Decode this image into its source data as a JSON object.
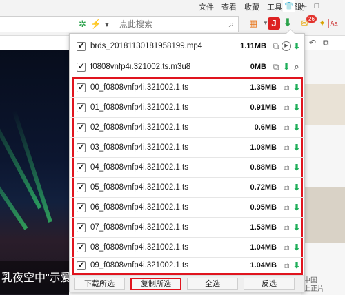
{
  "menubar": {
    "items": [
      "文件",
      "查看",
      "收藏",
      "工具",
      "帮助"
    ],
    "window_controls": {
      "shirt_icon": "shirt-icon",
      "minimize": "—",
      "maximize": "□"
    }
  },
  "toolbar": {
    "search_placeholder": "点此搜索",
    "icons": [
      "refresh-spin-icon",
      "lightning-icon",
      "chevron-down-icon",
      "search-icon",
      "apps-icon",
      "music-icon",
      "video-sniffer-icon",
      "chat-icon",
      "mail-icon",
      "pdf-icon"
    ],
    "music_glyph": "J",
    "pdf_glyph": "Aa",
    "chat_badge": "26"
  },
  "page": {
    "caption": "乳夜空中\"示爱\"",
    "right_text_1": "中国",
    "right_text_2": "上正片"
  },
  "popup": {
    "files": [
      {
        "name": "brds_20181130181958199.mp4",
        "size": "1.11MB",
        "actions": [
          "copy",
          "play",
          "download"
        ]
      },
      {
        "name": "f0808vnfp4i.321002.ts.m3u8",
        "size": "0MB",
        "actions": [
          "copy",
          "download",
          "inspect"
        ]
      },
      {
        "name": "00_f0808vnfp4i.321002.1.ts",
        "size": "1.35MB",
        "actions": [
          "copy",
          "download"
        ]
      },
      {
        "name": "01_f0808vnfp4i.321002.1.ts",
        "size": "0.91MB",
        "actions": [
          "copy",
          "download"
        ]
      },
      {
        "name": "02_f0808vnfp4i.321002.1.ts",
        "size": "0.6MB",
        "actions": [
          "copy",
          "download"
        ]
      },
      {
        "name": "03_f0808vnfp4i.321002.1.ts",
        "size": "1.08MB",
        "actions": [
          "copy",
          "download"
        ]
      },
      {
        "name": "04_f0808vnfp4i.321002.1.ts",
        "size": "0.88MB",
        "actions": [
          "copy",
          "download"
        ]
      },
      {
        "name": "05_f0808vnfp4i.321002.1.ts",
        "size": "0.72MB",
        "actions": [
          "copy",
          "download"
        ]
      },
      {
        "name": "06_f0808vnfp4i.321002.1.ts",
        "size": "0.95MB",
        "actions": [
          "copy",
          "download"
        ]
      },
      {
        "name": "07_f0808vnfp4i.321002.1.ts",
        "size": "1.53MB",
        "actions": [
          "copy",
          "download"
        ]
      },
      {
        "name": "08_f0808vnfp4i.321002.1.ts",
        "size": "1.04MB",
        "actions": [
          "copy",
          "download"
        ]
      },
      {
        "name": "09_f0808vnfp4i.321002.1.ts",
        "size": "1.04MB",
        "actions": [
          "copy",
          "download"
        ]
      }
    ],
    "buttons": {
      "download_selected": "下载所选",
      "copy_selected": "复制所选",
      "select_all": "全选",
      "invert_selection": "反选"
    },
    "highlight_color": "#e0141e",
    "download_icon_color": "#1fae5a"
  }
}
